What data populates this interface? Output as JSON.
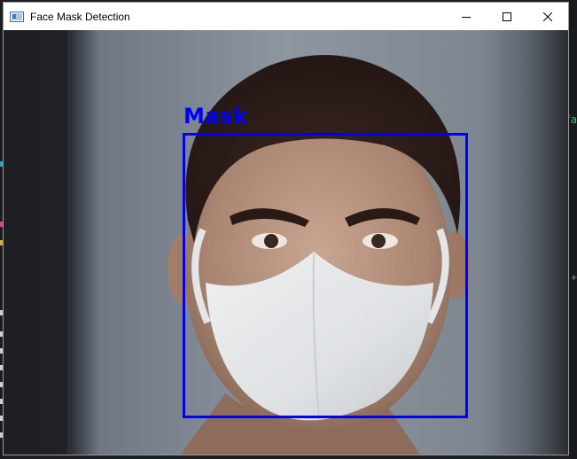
{
  "window": {
    "title": "Face Mask Detection",
    "app_icon": "opencv-window-icon",
    "controls": [
      "minimize-icon",
      "maximize-icon",
      "close-icon"
    ]
  },
  "detection": {
    "label": "Mask",
    "box_color": "#0000ff"
  },
  "background": {
    "right_glyph": "fa",
    "right_plus": "+"
  }
}
